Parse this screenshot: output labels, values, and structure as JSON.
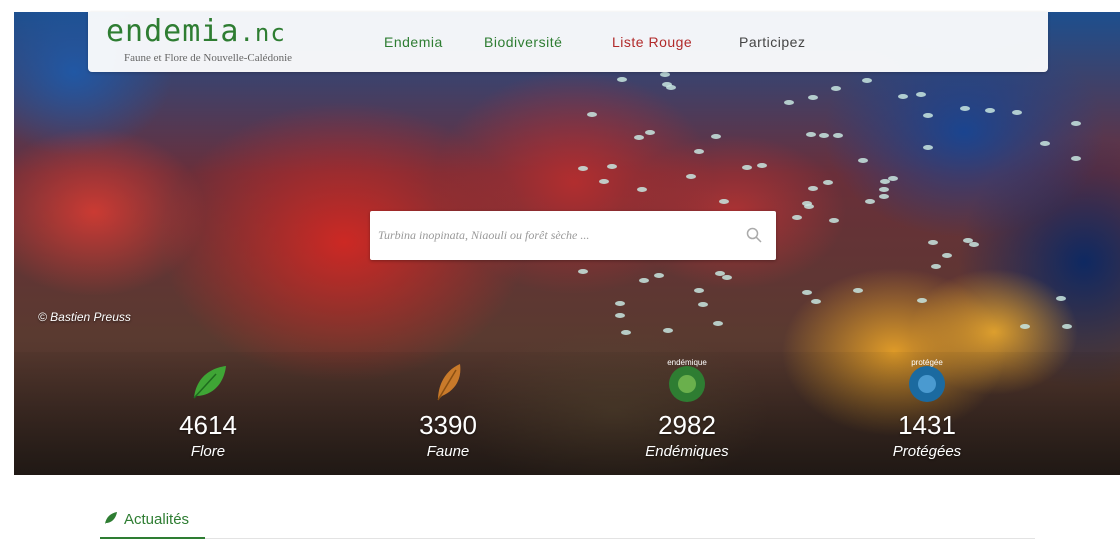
{
  "site": {
    "logo_main": "endemia",
    "logo_tld": ".nc",
    "tagline": "Faune et Flore de Nouvelle-Calédonie"
  },
  "nav": [
    {
      "label": "Endemia",
      "color": "#2e7d32"
    },
    {
      "label": "Biodiversité",
      "color": "#2e7d32"
    },
    {
      "label": "Liste Rouge",
      "color": "#b12a2a"
    },
    {
      "label": "Participez",
      "color": "#444444"
    }
  ],
  "search": {
    "placeholder": "Turbina inopinata, Niaouli ou forêt sèche ...",
    "icon": "search-icon"
  },
  "photo_credit": "© Bastien Preuss",
  "stats": [
    {
      "value": "4614",
      "label": "Flore",
      "icon": "leaf-icon",
      "color": "#3fa535"
    },
    {
      "value": "3390",
      "label": "Faune",
      "icon": "feather-icon",
      "color": "#c97a2a"
    },
    {
      "value": "2982",
      "label": "Endémiques",
      "icon": "endemique-badge-icon",
      "color": "#2e7d32",
      "badge_text": "endémique"
    },
    {
      "value": "1431",
      "label": "Protégées",
      "icon": "protegee-badge-icon",
      "color": "#1b6aa0",
      "badge_text": "protégée"
    }
  ],
  "news": {
    "title": "Actualités",
    "icon": "leaf-icon"
  }
}
